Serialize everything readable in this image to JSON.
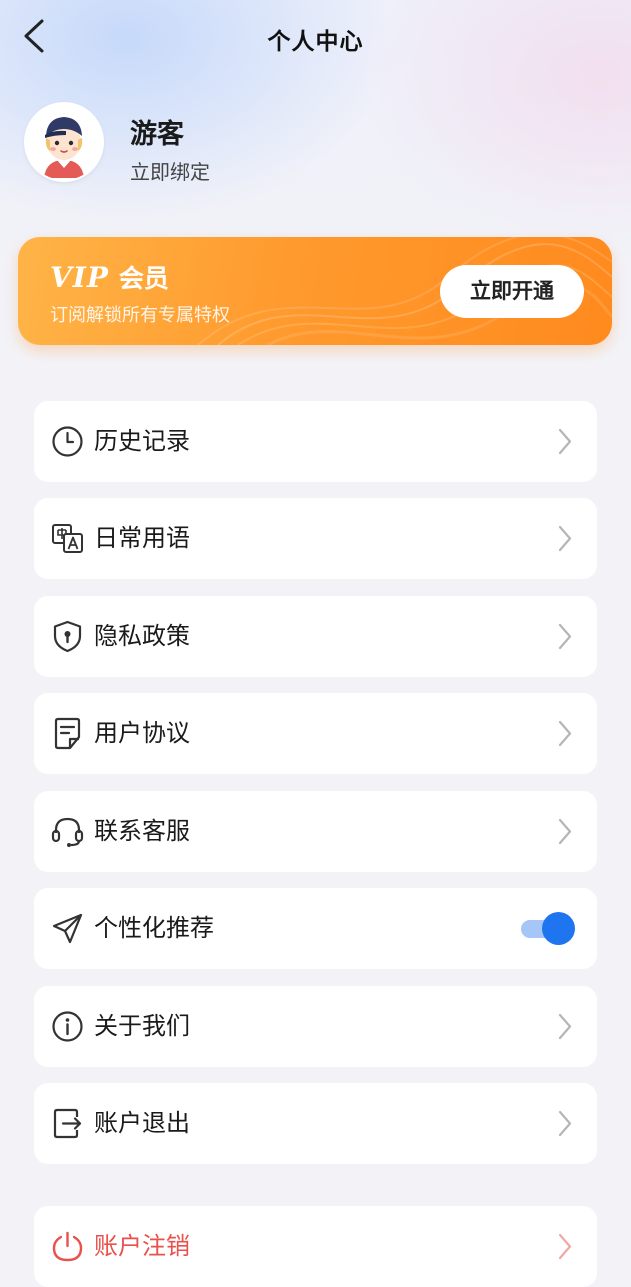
{
  "header": {
    "title": "个人中心",
    "back_icon": "chevron-left-icon"
  },
  "profile": {
    "name": "游客",
    "bind_label": "立即绑定",
    "avatar": "avatar-boy-cap"
  },
  "vip": {
    "logo": "VIP",
    "title": "会员",
    "subtitle": "订阅解锁所有专属特权",
    "button_label": "立即开通",
    "colors": {
      "start": "#ffb447",
      "end": "#ff8a1e"
    }
  },
  "menu": [
    {
      "label": "历史记录",
      "icon": "clock-icon",
      "action": "arrow"
    },
    {
      "label": "日常用语",
      "icon": "translate-icon",
      "action": "arrow"
    },
    {
      "label": "隐私政策",
      "icon": "shield-icon",
      "action": "arrow"
    },
    {
      "label": "用户协议",
      "icon": "document-icon",
      "action": "arrow"
    },
    {
      "label": "联系客服",
      "icon": "headset-icon",
      "action": "arrow"
    },
    {
      "label": "个性化推荐",
      "icon": "send-icon",
      "action": "toggle",
      "toggle_on": true
    },
    {
      "label": "关于我们",
      "icon": "info-icon",
      "action": "arrow"
    },
    {
      "label": "账户退出",
      "icon": "logout-icon",
      "action": "arrow"
    },
    {
      "label": "账户注销",
      "icon": "power-icon",
      "action": "arrow",
      "danger": true
    }
  ],
  "colors": {
    "accent": "#1f74f0",
    "danger": "#e8514c",
    "background": "#f3f3f7"
  }
}
